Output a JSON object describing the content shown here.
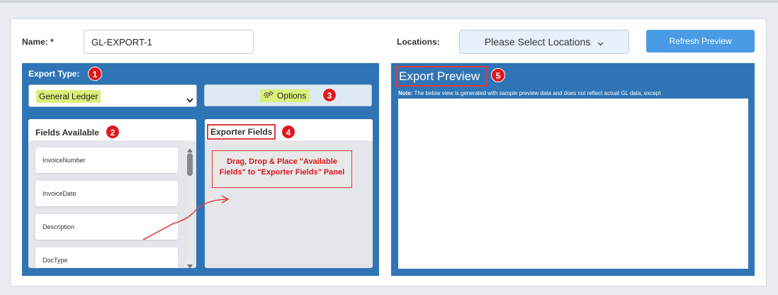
{
  "form": {
    "name_label": "Name: *",
    "name_value": "GL-EXPORT-1",
    "locations_label": "Locations:",
    "locations_placeholder": "Please Select Locations",
    "refresh_label": "Refresh Preview"
  },
  "export_type": {
    "label": "Export Type:",
    "selected": "General Ledger",
    "options_label": "Options"
  },
  "fields_available": {
    "title": "Fields Available",
    "items": [
      "InvoiceNumber",
      "InvoiceDate",
      "Description",
      "DocType"
    ]
  },
  "exporter_fields": {
    "title": "Exporter Fields"
  },
  "callout": {
    "text": "Drag, Drop & Place \"Available Fields\" to \"Exporter Fields\" Panel"
  },
  "preview": {
    "title": "Export Preview",
    "note_bold": "Note:",
    "note_text": " The below view is generated with sample preview data and does not reflect actual GL data, except"
  },
  "badges": [
    "1",
    "2",
    "3",
    "4",
    "5"
  ],
  "colors": {
    "panel_blue": "#2f74b5",
    "refresh_blue": "#4a9be6",
    "highlight": "#d9f07a",
    "annotation_red": "#e0171d"
  }
}
